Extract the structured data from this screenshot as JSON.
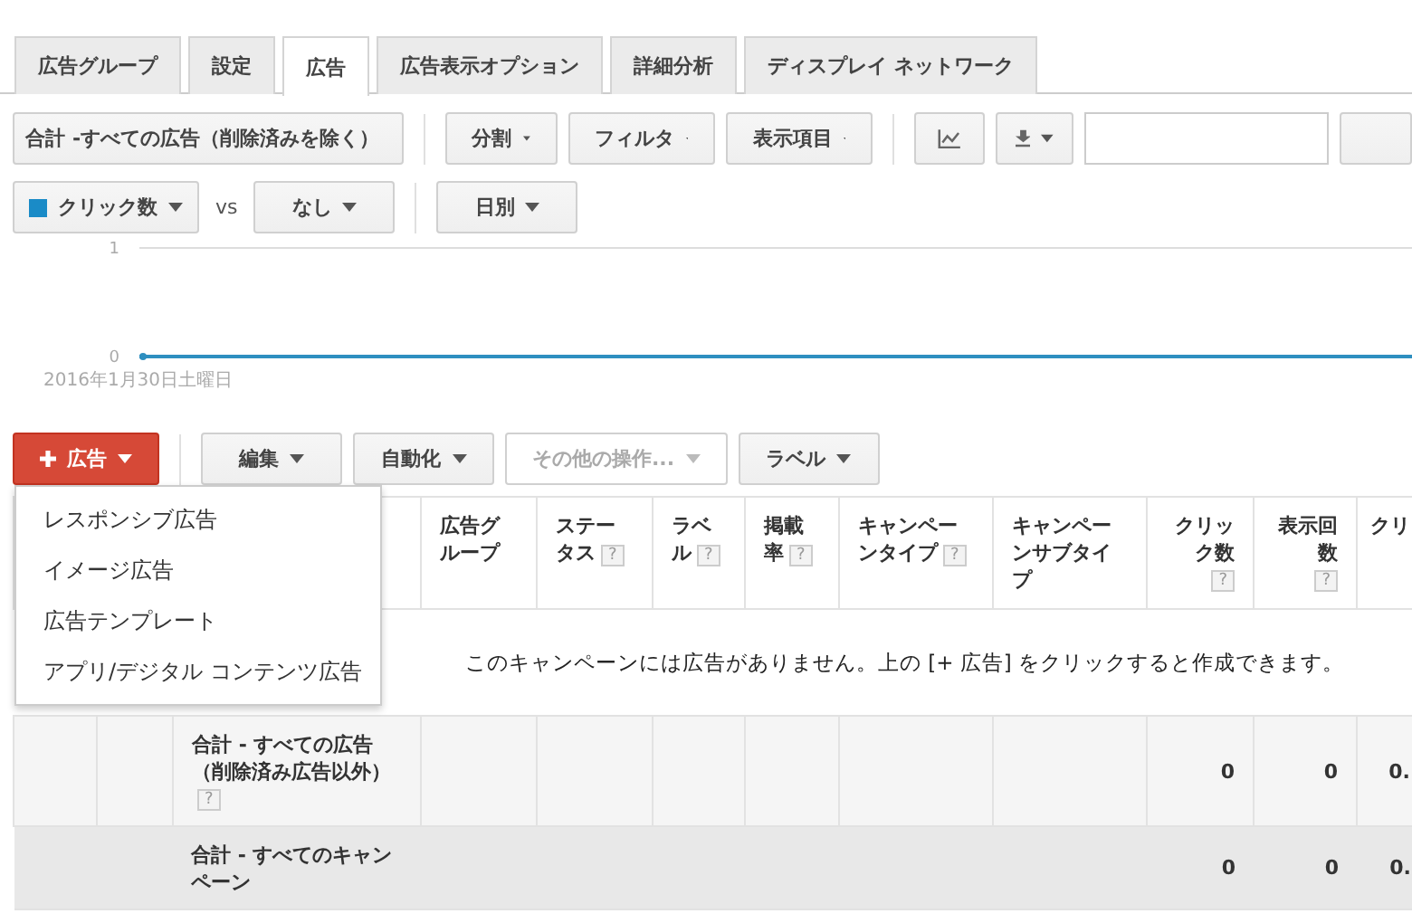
{
  "tabs": [
    {
      "label": "広告グループ",
      "selected": false
    },
    {
      "label": "設定",
      "selected": false
    },
    {
      "label": "広告",
      "selected": true
    },
    {
      "label": "広告表示オプション",
      "selected": false
    },
    {
      "label": "詳細分析",
      "selected": false
    },
    {
      "label": "ディスプレイ ネットワーク",
      "selected": false
    }
  ],
  "toolbar": {
    "groups": [
      [
        {
          "kind": "dropdown",
          "label": "合計 -すべての広告（削除済みを除く）"
        }
      ],
      [
        {
          "kind": "dropdown",
          "label": "分割"
        },
        {
          "kind": "dropdown",
          "label": "フィルタ"
        },
        {
          "kind": "dropdown",
          "label": "表示項目"
        }
      ],
      [
        {
          "kind": "chart"
        },
        {
          "kind": "download"
        },
        {
          "kind": "search"
        },
        {
          "kind": "cut"
        }
      ]
    ]
  },
  "metrics": {
    "primary": {
      "label": "クリック数",
      "color": "#1a8bc7"
    },
    "vs": "vs",
    "compare": "なし",
    "period": "日別"
  },
  "chart_data": {
    "type": "line",
    "x": [
      "2016年1月30日土曜日"
    ],
    "yticks": [
      0,
      1
    ],
    "ylim": [
      0,
      1
    ],
    "series": [
      {
        "color": "#2e8fc0",
        "marker": true,
        "values": [
          0
        ]
      }
    ]
  },
  "actions": [
    {
      "kind": "primary",
      "label": "広告",
      "disabled": false
    },
    {
      "kind": "dropdown",
      "label": "編集",
      "disabled": false
    },
    {
      "kind": "dropdown",
      "label": "自動化",
      "disabled": false
    },
    {
      "kind": "dropdown",
      "label": "その他の操作...",
      "disabled": true
    },
    {
      "kind": "dropdown",
      "label": "ラベル",
      "disabled": false
    }
  ],
  "menu": {
    "items": [
      "レスポンシブ広告",
      "イメージ広告",
      "広告テンプレート",
      "アプリ/デジタル コンテンツ広告"
    ]
  },
  "table": {
    "columns": [
      {
        "label": "広告グループ"
      },
      {
        "label": "ステータス",
        "help": "?"
      },
      {
        "label": "ラベル",
        "help": "?"
      },
      {
        "label": "掲載率",
        "help": "?"
      },
      {
        "label": "キャンペーンタイプ",
        "help": "?"
      },
      {
        "label": "キャンペーンサブタイプ"
      },
      {
        "label": "クリック数",
        "help": "?",
        "numeric": true
      },
      {
        "label": "表示回数",
        "help": "?",
        "numeric": true
      },
      {
        "label": "クリ",
        "numeric": true
      }
    ],
    "empty_message": "このキャンペーンには広告がありません。上の [+ 広告] をクリックすると作成できます。",
    "rows": [
      {
        "kind": "subtotal",
        "label": "合計 - すべての広告（削除済み広告以外）",
        "help": "?",
        "values": [
          "0",
          "0",
          "0."
        ]
      },
      {
        "kind": "total",
        "label": "合計 - すべてのキャンペーン",
        "values": [
          "0",
          "0",
          "0."
        ]
      }
    ]
  }
}
